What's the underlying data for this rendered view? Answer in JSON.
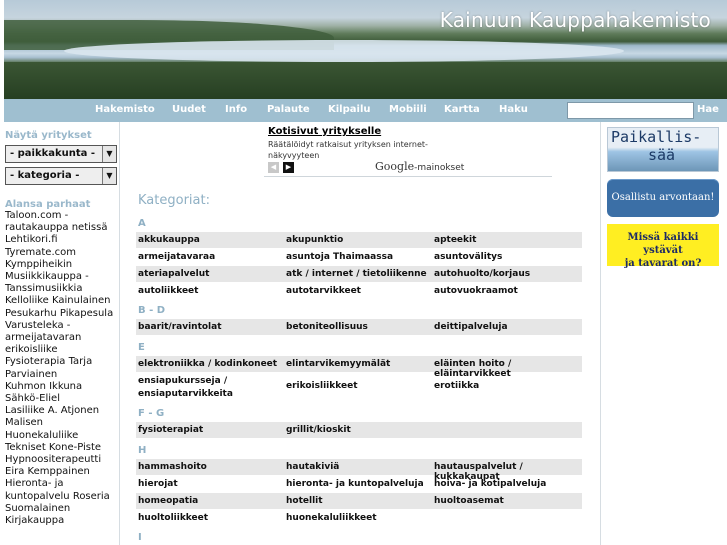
{
  "site": {
    "title": "Kainuun Kauppahakemisto"
  },
  "nav": {
    "items": [
      "Hakemisto",
      "Uudet",
      "Info",
      "Palaute",
      "Kilpailu",
      "Mobiili",
      "Kartta",
      "Haku"
    ],
    "search_placeholder": "",
    "search_button": "Hae"
  },
  "sidebar": {
    "show_label": "Näytä yritykset",
    "locality_select": "- paikkakunta -",
    "category_select": "- kategoria -",
    "best_label": "Alansa parhaat",
    "partners": [
      "Taloon.com - rautakauppa netissä",
      "Lehtikori.fi",
      "Tyremate.com",
      "Kymppiheikin Musiikkikauppa - Tanssimusiikkia",
      "Kelloliike Kainulainen",
      "Pesukarhu Pikapesula",
      "Varusteleka - armeijatavaran erikoisliike",
      "Fysioterapia Tarja Parviainen",
      "Kuhmon Ikkuna",
      "Sähkö-Eliel",
      "Lasiliike A. Atjonen",
      "Malisen Huonekaluliike",
      "Tekniset Kone-Piste",
      "Hypnoositerapeutti Eira Kemppainen",
      "Hieronta- ja kuntopalvelu Roseria",
      "Suomalainen Kirjakauppa"
    ]
  },
  "ad": {
    "title": "Kotisivut yritykselle",
    "text": "Räätälöidyt ratkaisut yrityksen internet-näkyvyyteen",
    "prev": "◀",
    "next": "▶",
    "google_logo": "Google",
    "google_suffix": "-mainokset"
  },
  "categories": {
    "title": "Kategoriat:",
    "sections": [
      {
        "label": "A",
        "rows": [
          [
            "akkukauppa",
            "akupunktio",
            "apteekit"
          ],
          [
            "armeijatavaraa",
            "asuntoja Thaimaassa",
            "asuntovälitys"
          ],
          [
            "ateriapalvelut",
            "atk / internet / tietoliikenne",
            "autohuolto/korjaus"
          ],
          [
            "autoliikkeet",
            "autotarvikkeet",
            "autovuokraamot"
          ]
        ]
      },
      {
        "label": "B - D",
        "rows": [
          [
            "baarit/ravintolat",
            "betoniteollisuus",
            "deittipalveluja"
          ]
        ]
      },
      {
        "label": "E",
        "rows": [
          [
            "elektroniikka / kodinkoneet",
            "elintarvikemyymälät",
            "eläinten hoito / eläintarvikkeet"
          ],
          [
            "ensiapukursseja / ensiaputarvikkeita",
            "erikoisliikkeet",
            "erotiikka"
          ]
        ]
      },
      {
        "label": "F - G",
        "rows": [
          [
            "fysioterapiat",
            "grillit/kioskit",
            ""
          ]
        ]
      },
      {
        "label": "H",
        "rows": [
          [
            "hammashoito",
            "hautakiviä",
            "hautauspalvelut / kukkakaupat"
          ],
          [
            "hierojat",
            "hieronta- ja kuntopalveluja",
            "hoiva- ja kotipalveluja"
          ],
          [
            "homeopatia",
            "hotellit",
            "huoltoasemat"
          ],
          [
            "huoltoliikkeet",
            "huonekaluliikkeet",
            ""
          ]
        ]
      },
      {
        "label": "I",
        "rows": []
      }
    ]
  },
  "right": {
    "saa_line1": "Paikallis-",
    "saa_line2": "sää",
    "contest_button": "Osallistu arvontaan!",
    "missa_line1": "Missä kaikki ystävät",
    "missa_line2": "ja tavarat on?"
  }
}
